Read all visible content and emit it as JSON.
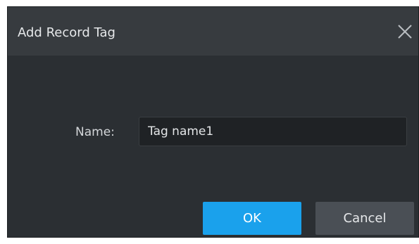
{
  "dialog": {
    "title": "Add Record Tag",
    "close_icon": "close-icon",
    "name_label": "Name:",
    "name_value": "Tag name1",
    "ok_label": "OK",
    "cancel_label": "Cancel"
  },
  "colors": {
    "dialog_bg": "#2b2f33",
    "titlebar_bg": "#373b3f",
    "input_bg": "#1f2225",
    "primary": "#1aa1ec",
    "secondary_button": "#4a4f55"
  }
}
